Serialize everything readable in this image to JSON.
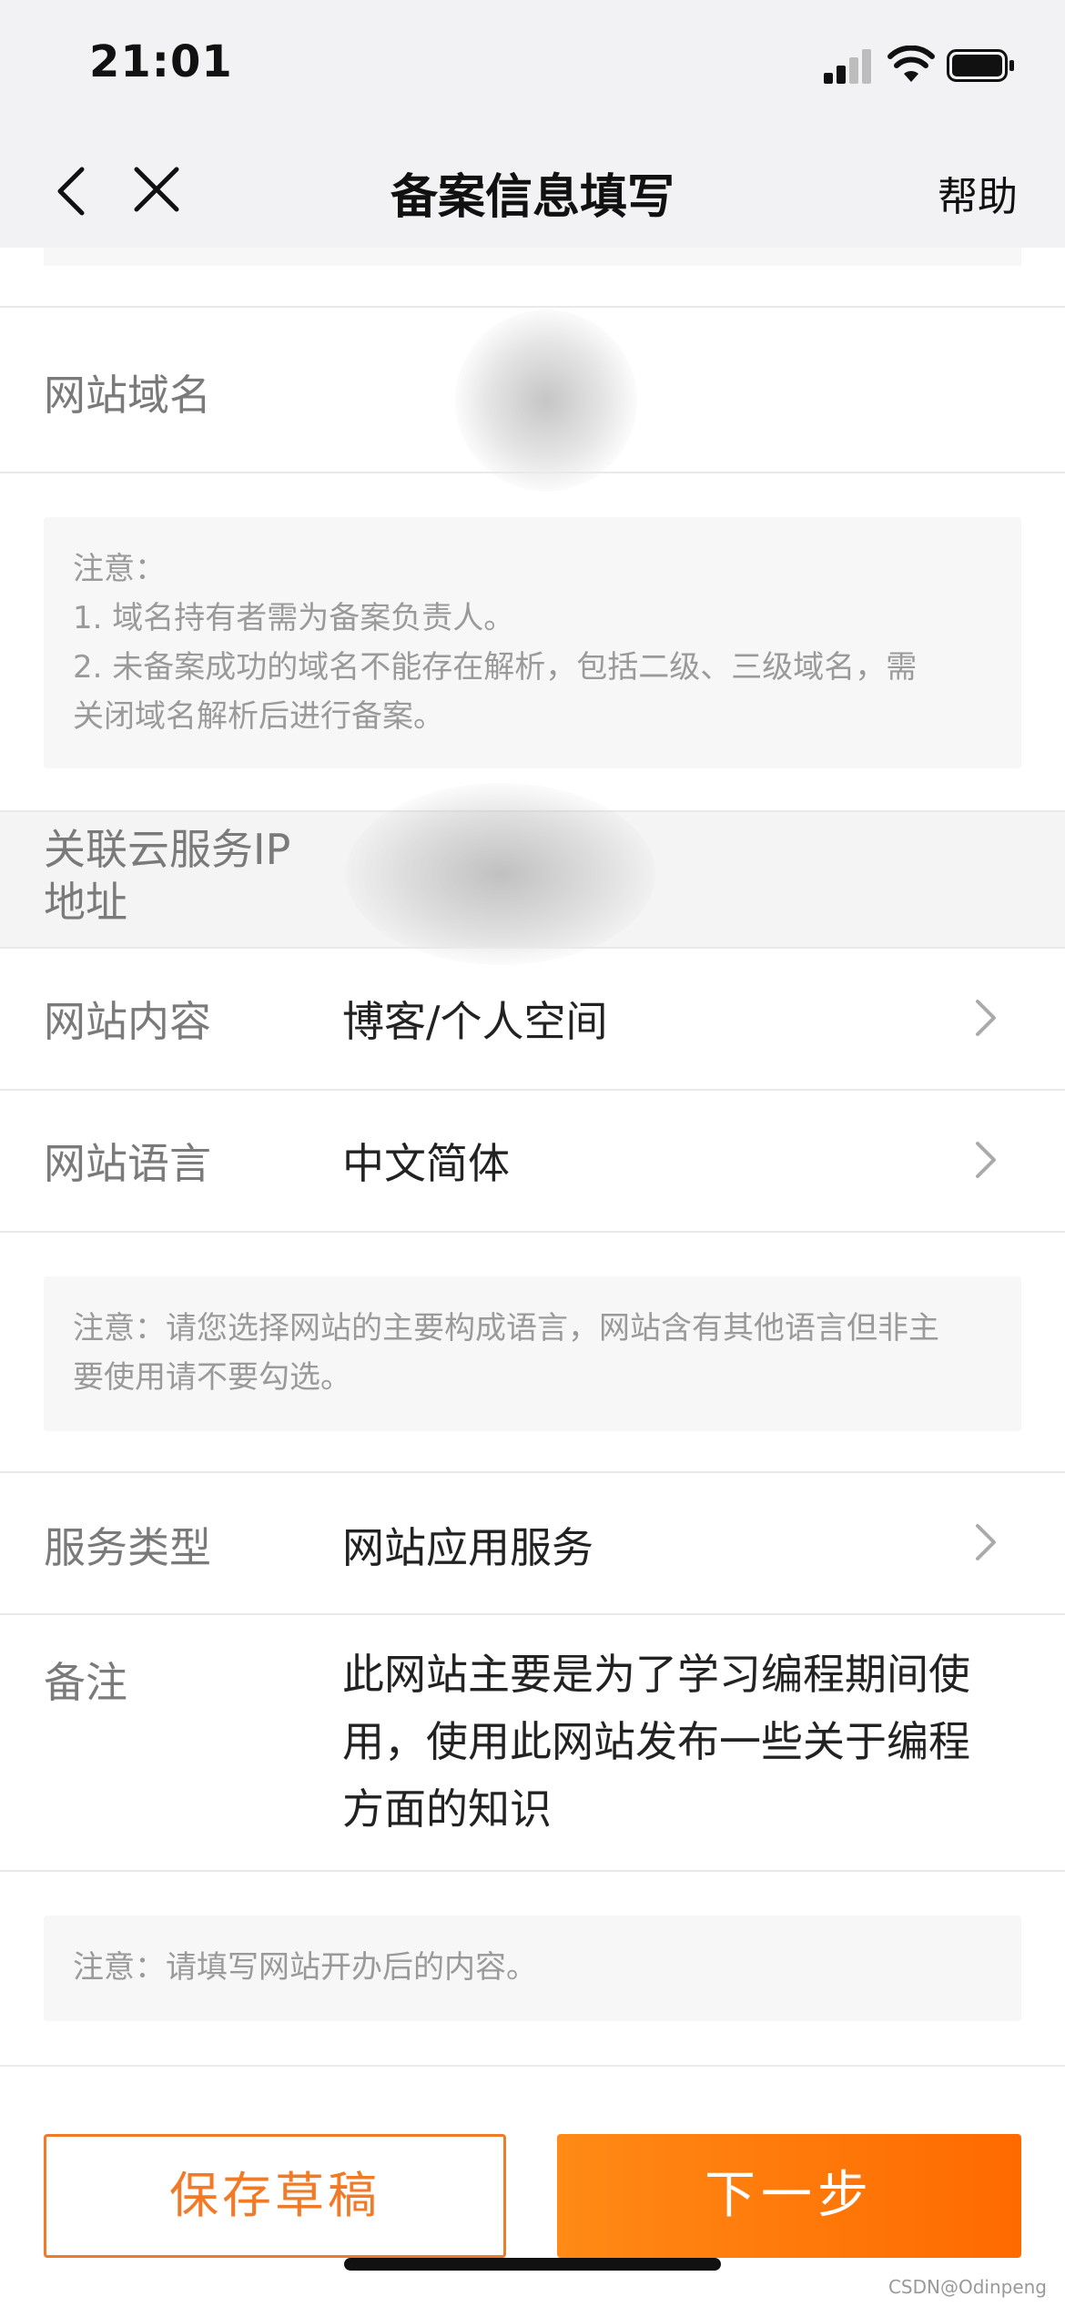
{
  "status_bar": {
    "time": "21:01"
  },
  "nav": {
    "title": "备案信息填写",
    "help": "帮助"
  },
  "fields": {
    "domain": {
      "label": "网站域名"
    },
    "ip": {
      "label_line1": "关联云服务IP",
      "label_line2": "地址"
    },
    "content": {
      "label": "网站内容",
      "value": "博客/个人空间"
    },
    "language": {
      "label": "网站语言",
      "value": "中文简体"
    },
    "service_type": {
      "label": "服务类型",
      "value": "网站应用服务"
    },
    "remark": {
      "label": "备注",
      "line1": "此网站主要是为了学习编程期间使",
      "line2": "用，使用此网站发布一些关于编程",
      "line3": "方面的知识"
    }
  },
  "notices": {
    "domain": {
      "line1": "注意：",
      "line2": "1. 域名持有者需为备案负责人。",
      "line3": "2. 未备案成功的域名不能存在解析，包括二级、三级域名，需",
      "line4": "关闭域名解析后进行备案。"
    },
    "language": {
      "line1": "注意：请您选择网站的主要构成语言，网站含有其他语言但非主",
      "line2": "要使用请不要勾选。"
    },
    "remark": {
      "line1": "注意：请填写网站开办后的内容。"
    }
  },
  "buttons": {
    "save_draft": "保存草稿",
    "next": "下一步"
  },
  "watermark": "CSDN@Odinpeng",
  "colors": {
    "accent": "#ff7a00",
    "nav_bg": "#f2f2f4",
    "notice_bg": "#f7f7f7"
  }
}
